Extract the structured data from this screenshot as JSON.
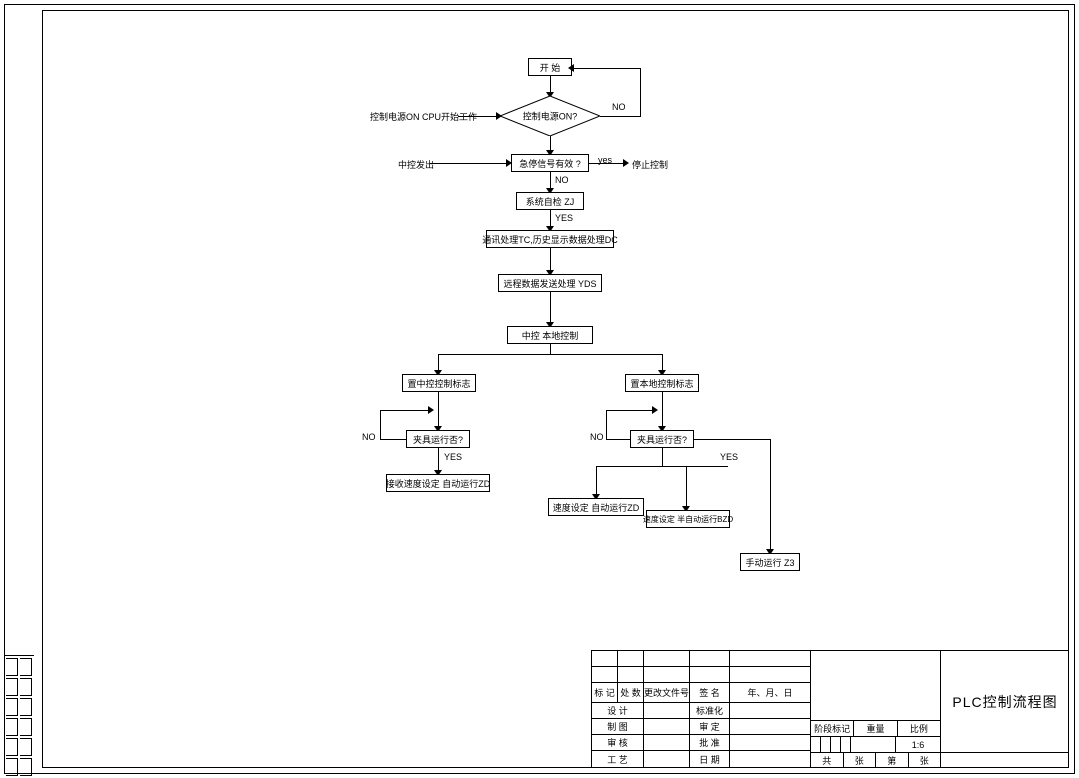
{
  "flow": {
    "start": "开 始",
    "power_on_q": "控制电源ON?",
    "power_on_side": "控制电源ON CPU开始工作",
    "power_no": "NO",
    "stop_signal_q": "急停信号有效 ?",
    "stop_signal_side": "中控发出",
    "stop_yes": "yes",
    "stop_no": "NO",
    "stop_ctrl": "停止控制",
    "sys_self": "系统自检 ZJ",
    "sys_yes": "YES",
    "proc_tc": "通讯处理TC,历史显示数据处理DC",
    "yds": "远程数据发送处理 YDS",
    "mode": "中控 本地控制",
    "set_central": "置中控控制标志",
    "set_local": "置本地控制标志",
    "clamp_q_l": "夹具运行否?",
    "clamp_q_r": "夹具运行否?",
    "clamp_no_l": "NO",
    "clamp_no_r": "NO",
    "clamp_yes_l": "YES",
    "clamp_yes_r": "YES",
    "recv_speed": "接收速度设定 自动运行ZD",
    "speed_auto": "速度设定 自动运行ZD",
    "speed_bzd": "速度设定 半自动运行BZD",
    "manual": "手动运行 Z3"
  },
  "titleblock": {
    "h1": "标 记",
    "h2": "处 数",
    "h3": "更改文件号",
    "h4": "签 名",
    "h5": "年、月、日",
    "r1": "设 计",
    "r2": "制 图",
    "r3": "审 核",
    "r4": "工 艺",
    "m1": "标准化",
    "m2": "审 定",
    "m3": "批 准",
    "m4": "日 期",
    "stage": "阶段标记",
    "weight": "重量",
    "scale": "比例",
    "scale_v": "1:6",
    "sheet1": "共",
    "sheet2": "张",
    "sheet3": "第",
    "sheet4": "张",
    "title": "PLC控制流程图"
  }
}
